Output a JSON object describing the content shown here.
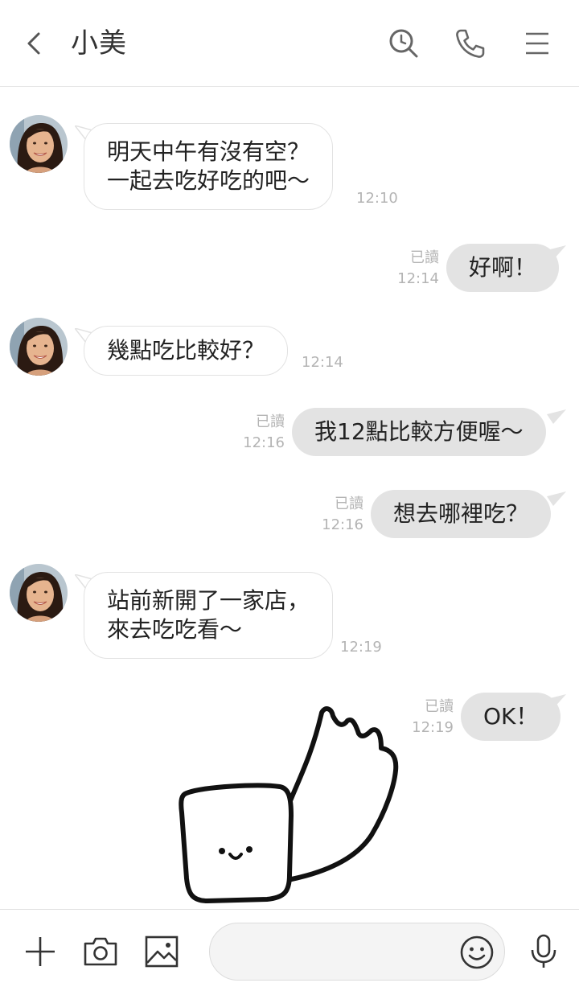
{
  "header": {
    "title": "小美",
    "icons": [
      "back-icon",
      "search-icon",
      "phone-icon",
      "menu-icon"
    ]
  },
  "messages": [
    {
      "side": "in",
      "text_lines": [
        "明天中午有沒有空？",
        "一起去吃好吃的吧～"
      ],
      "time": "12:10"
    },
    {
      "side": "out",
      "text": "好啊！",
      "read": "已讀",
      "time": "12:14"
    },
    {
      "side": "in",
      "text_lines": [
        "幾點吃比較好？"
      ],
      "time": "12:14"
    },
    {
      "side": "out",
      "text": "我12點比較方便喔～",
      "read": "已讀",
      "time": "12:16"
    },
    {
      "side": "out",
      "text": "想去哪裡吃？",
      "read": "已讀",
      "time": "12:16"
    },
    {
      "side": "in",
      "text_lines": [
        "站前新開了一家店，",
        "來去吃吃看～"
      ],
      "time": "12:19"
    },
    {
      "side": "out",
      "text": "OK！",
      "read": "已讀",
      "time": "12:19"
    }
  ],
  "input_bar": {
    "placeholder": "",
    "icons": [
      "plus-icon",
      "camera-icon",
      "image-icon",
      "emoji-icon",
      "microphone-icon"
    ]
  },
  "colors": {
    "outgoing_bubble": "#e3e3e3",
    "incoming_bubble": "#ffffff",
    "meta_text": "#b4b4b4"
  }
}
